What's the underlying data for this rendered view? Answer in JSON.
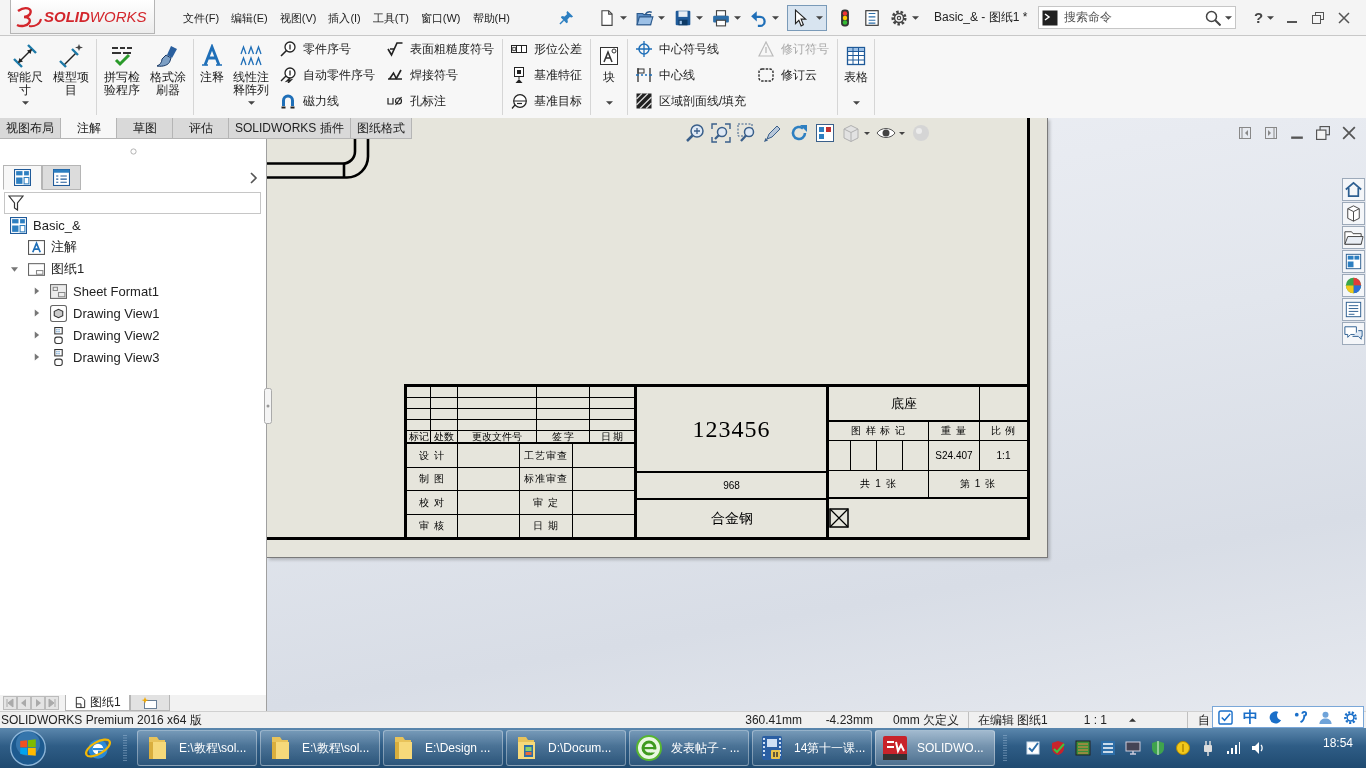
{
  "app": {
    "logo": "**SOLID**WORKS",
    "menus": [
      "文件(F)",
      "编辑(E)",
      "视图(V)",
      "插入(I)",
      "工具(T)",
      "窗口(W)",
      "帮助(H)"
    ],
    "document_title": "Basic_& - 图纸1 *",
    "search": {
      "placeholder": "搜索命令"
    },
    "help": "?"
  },
  "ribbon": {
    "groups": [
      {
        "columns": [
          {
            "kind": "large",
            "label": "智能尺寸",
            "dropdown": true
          },
          {
            "kind": "large",
            "label": "模型项目",
            "dropdown": false
          }
        ]
      },
      {
        "columns": [
          {
            "kind": "large",
            "label": "拼写检验程序",
            "dropdown": false
          },
          {
            "kind": "large",
            "label": "格式涂刷器",
            "dropdown": false
          }
        ]
      },
      {
        "columns": [
          {
            "kind": "large",
            "label": "注释",
            "dropdown": false
          },
          {
            "kind": "large",
            "label": "线性注释阵列",
            "dropdown": true
          },
          {
            "kind": "stack",
            "items": [
              {
                "label": "零件序号",
                "disabled": false
              },
              {
                "label": "自动零件序号",
                "disabled": false
              },
              {
                "label": "磁力线",
                "disabled": false
              }
            ]
          },
          {
            "kind": "stack",
            "items": [
              {
                "label": "表面粗糙度符号",
                "disabled": false
              },
              {
                "label": "焊接符号",
                "disabled": false
              },
              {
                "label": "孔标注",
                "disabled": false
              }
            ]
          }
        ]
      },
      {
        "columns": [
          {
            "kind": "stack",
            "items": [
              {
                "label": "形位公差",
                "disabled": false
              },
              {
                "label": "基准特征",
                "disabled": false
              },
              {
                "label": "基准目标",
                "disabled": false
              }
            ]
          }
        ]
      },
      {
        "columns": [
          {
            "kind": "large",
            "label": "块",
            "dropdown": true
          }
        ]
      },
      {
        "columns": [
          {
            "kind": "stack",
            "items": [
              {
                "label": "中心符号线",
                "disabled": false
              },
              {
                "label": "中心线",
                "disabled": false
              },
              {
                "label": "区域剖面线/填充",
                "disabled": false
              }
            ]
          },
          {
            "kind": "stack",
            "items": [
              {
                "label": "修订符号",
                "disabled": true
              },
              {
                "label": "修订云",
                "disabled": false
              }
            ]
          }
        ]
      },
      {
        "columns": [
          {
            "kind": "large",
            "label": "表格",
            "dropdown": true
          }
        ]
      }
    ]
  },
  "command_tabs": [
    {
      "label": "视图布局",
      "selected": false
    },
    {
      "label": "注解",
      "selected": true
    },
    {
      "label": "草图",
      "selected": false
    },
    {
      "label": "评估",
      "selected": false
    },
    {
      "label": "SOLIDWORKS 插件",
      "selected": false
    },
    {
      "label": "图纸格式",
      "selected": false
    }
  ],
  "feature_manager": {
    "tabs": [
      {
        "selected": true
      },
      {
        "selected": false
      }
    ],
    "tree": [
      {
        "kind": "drawing",
        "label": "Basic_&",
        "children": [
          {
            "kind": "annotations",
            "label": "注解"
          },
          {
            "kind": "sheet",
            "label": "图纸1",
            "expanded": true,
            "children": [
              {
                "kind": "sheet-format",
                "label": "Sheet Format1",
                "expanded": false
              },
              {
                "kind": "view-3d",
                "label": "Drawing View1",
                "expanded": false
              },
              {
                "kind": "view-projected",
                "label": "Drawing View2",
                "expanded": false
              },
              {
                "kind": "view-projected",
                "label": "Drawing View3",
                "expanded": false
              }
            ]
          }
        ]
      }
    ]
  },
  "title_block": {
    "revision_header": [
      "标记",
      "处数",
      "更改文件号",
      "签 字",
      "日 期"
    ],
    "approvals": [
      {
        "role": "设 计",
        "check": "工艺审查"
      },
      {
        "role": "制 图",
        "check": "标准审查"
      },
      {
        "role": "校 对",
        "check": "审 定"
      },
      {
        "role": "审 核",
        "check": "日 期"
      }
    ],
    "drawing_number": "123456",
    "code": "968",
    "material": "合金钢",
    "part_name": "底座",
    "info_header": [
      "图 样 标 记",
      "重 量",
      "比 例"
    ],
    "weight": "S24.407",
    "scale": "1:1",
    "sheet_count": "共 1 张",
    "sheet_number": "第 1 张"
  },
  "sheet_tabs": [
    {
      "label": "图纸1",
      "selected": true
    }
  ],
  "status_bar": {
    "product": "SOLIDWORKS Premium 2016 x64 版",
    "x": "360.41mm",
    "y": "-4.23mm",
    "z": "0mm",
    "sketch_state": "欠定义",
    "editing": "在编辑 图纸1",
    "scale": "1 : 1",
    "units": "自"
  },
  "ime_bar": {
    "mode": "中"
  },
  "taskbar": {
    "buttons": [
      {
        "kind": "folder",
        "label": "E:\\教程\\sol...",
        "selected": false
      },
      {
        "kind": "folder",
        "label": "E:\\教程\\sol...",
        "selected": false
      },
      {
        "kind": "folder",
        "label": "E:\\Design ...",
        "selected": false
      },
      {
        "kind": "media-folder",
        "label": "D:\\Docum...",
        "selected": false
      },
      {
        "kind": "browser",
        "label": "发表帖子 - ...",
        "selected": false
      },
      {
        "kind": "video",
        "label": "14第十一课...",
        "selected": false
      },
      {
        "kind": "solidworks",
        "label": "SOLIDWO...",
        "selected": true
      }
    ],
    "clock": "18:54"
  }
}
